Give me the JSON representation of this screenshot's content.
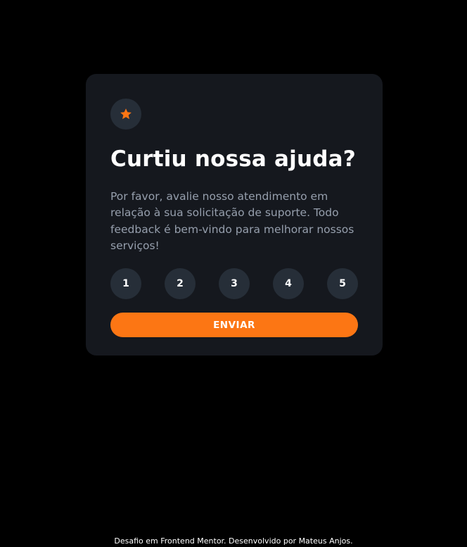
{
  "card": {
    "icon": "star-icon",
    "title": "Curtiu nossa ajuda?",
    "description": "Por favor, avalie nosso atendimento em relação à sua solicitação de suporte. Todo feedback é bem-vindo para melhorar nossos serviços!",
    "ratings": [
      "1",
      "2",
      "3",
      "4",
      "5"
    ],
    "submit_label": "ENVIAR"
  },
  "footer": {
    "text": "Desafio em Frontend Mentor. Desenvolvido por Mateus Anjos."
  },
  "colors": {
    "background": "#000000",
    "card": "#15181e",
    "circle": "#262e38",
    "accent": "#fc7614",
    "text_muted": "#969fad",
    "text": "#ffffff"
  }
}
